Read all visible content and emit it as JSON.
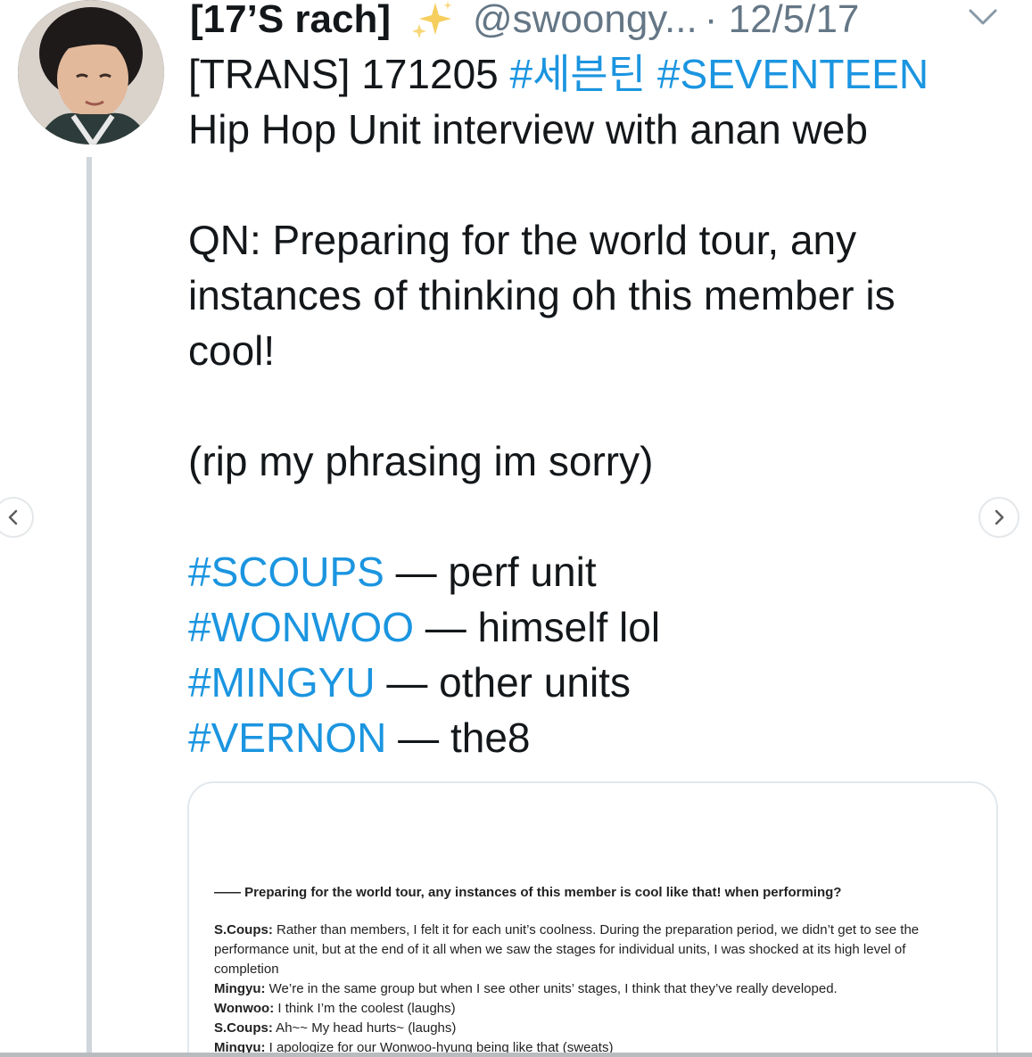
{
  "tweet": {
    "display_name": "[17’S rach]",
    "handle": "@swoongy...",
    "date": "· 12/5/17",
    "lines": [
      {
        "parts": [
          {
            "text": "[TRANS] 171205 ",
            "tag": false
          },
          {
            "text": "#세븐틴",
            "tag": true
          },
          {
            "text": " ",
            "tag": false
          },
          {
            "text": "#SEVENTEEN",
            "tag": true
          }
        ]
      },
      {
        "parts": [
          {
            "text": "Hip Hop Unit interview with anan web",
            "tag": false
          }
        ]
      },
      {
        "blank": true
      },
      {
        "parts": [
          {
            "text": "QN: Preparing for the world tour, any",
            "tag": false
          }
        ]
      },
      {
        "parts": [
          {
            "text": "instances of thinking oh this member is",
            "tag": false
          }
        ]
      },
      {
        "parts": [
          {
            "text": "cool!",
            "tag": false
          }
        ]
      },
      {
        "blank": true
      },
      {
        "parts": [
          {
            "text": "(rip my phrasing im sorry)",
            "tag": false
          }
        ]
      },
      {
        "blank": true
      },
      {
        "parts": [
          {
            "text": "#SCOUPS",
            "tag": true
          },
          {
            "text": " — perf unit",
            "tag": false
          }
        ]
      },
      {
        "parts": [
          {
            "text": "#WONWOO",
            "tag": true
          },
          {
            "text": " — himself lol",
            "tag": false
          }
        ]
      },
      {
        "parts": [
          {
            "text": "#MINGYU",
            "tag": true
          },
          {
            "text": " — other units",
            "tag": false
          }
        ]
      },
      {
        "parts": [
          {
            "text": "#VERNON",
            "tag": true
          },
          {
            "text": " — the8",
            "tag": false
          }
        ]
      }
    ]
  },
  "attachment": {
    "question": "—— Preparing for the world tour, any instances of this member is cool like that! when performing?",
    "entries": [
      {
        "speaker": "S.Coups:",
        "text": " Rather than members, I felt it for each unit’s coolness. During the preparation period, we didn’t get to see the performance unit, but at the end of it all when we saw the stages for individual units, I was shocked at its high level of completion"
      },
      {
        "speaker": "Mingyu:",
        "text": " We’re in the same group but when I see other units’ stages, I think that they’ve really developed."
      },
      {
        "speaker": "Wonwoo:",
        "text": " I think I’m the coolest (laughs)"
      },
      {
        "speaker": "S.Coups:",
        "text": " Ah~~ My head hurts~ (laughs)"
      },
      {
        "speaker": "Mingyu:",
        "text": " I apologize for our Wonwoo-hyung being like that (sweats)"
      }
    ]
  },
  "icons": {
    "sparkle": "sparkles-icon",
    "menu": "chevron-down-icon",
    "prev": "chevron-left-icon",
    "next": "chevron-right-icon"
  },
  "colors": {
    "hashtag": "#1b95e0",
    "muted": "#657786",
    "text": "#14171a",
    "thread_line": "#cfd6dc",
    "sparkle": "#f5c542"
  }
}
